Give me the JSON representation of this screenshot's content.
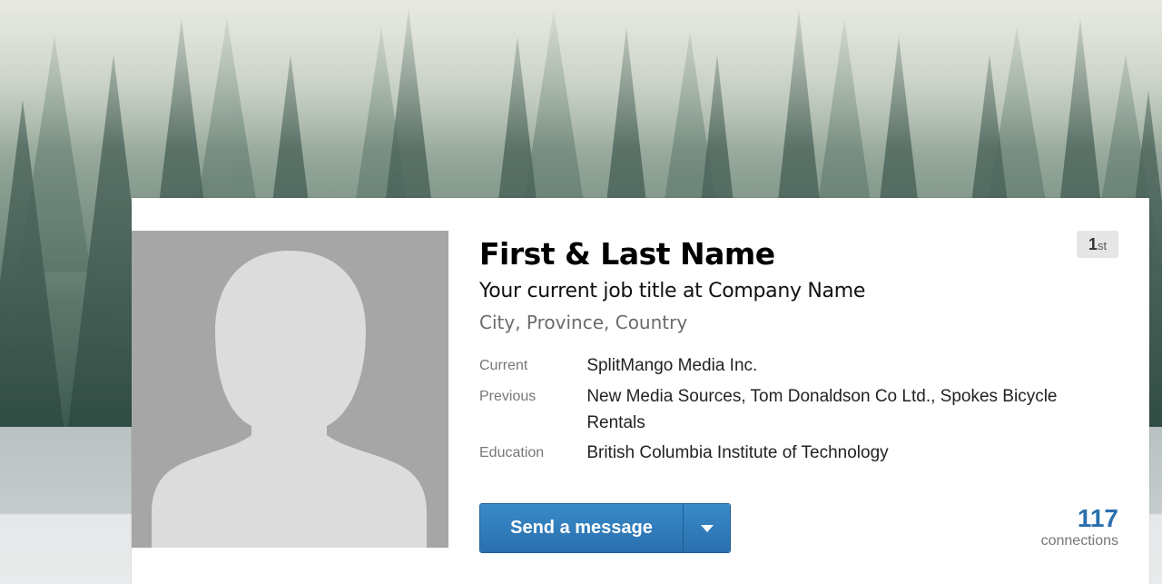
{
  "profile": {
    "name": "First & Last Name",
    "headline": "Your current job title at Company Name",
    "location": "City, Province, Country",
    "degree": {
      "number": "1",
      "suffix": "st"
    },
    "details": [
      {
        "label": "Current",
        "value": "SplitMango Media Inc."
      },
      {
        "label": "Previous",
        "value": "New Media Sources, Tom Donaldson Co Ltd., Spokes Bicycle Rentals"
      },
      {
        "label": "Education",
        "value": "British Columbia Institute of Technology"
      }
    ],
    "actions": {
      "send_message": "Send a message",
      "dropdown_icon": "caret-down-icon"
    },
    "connections": {
      "count": "117",
      "label": "connections"
    }
  },
  "colors": {
    "accent": "#2a6fae",
    "button_top": "#3a8bc9",
    "photo_bg": "#a6a6a6",
    "silhouette": "#dcdcdc"
  }
}
